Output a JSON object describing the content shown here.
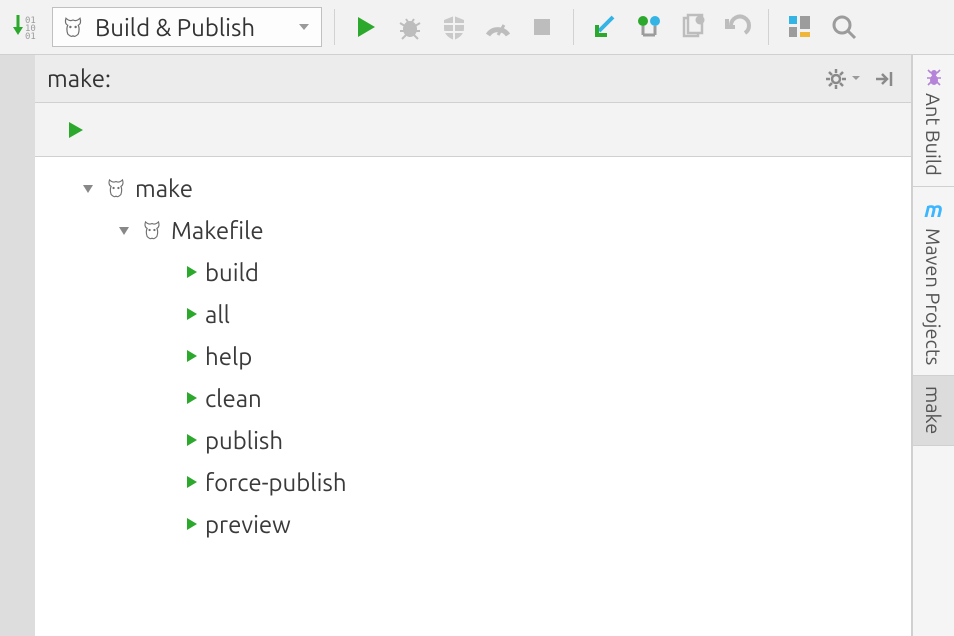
{
  "toolbar": {
    "run_config_label": "Build & Publish"
  },
  "panel": {
    "title": "make:"
  },
  "tree": {
    "root": {
      "label": "make"
    },
    "makefile": {
      "label": "Makefile"
    },
    "targets": [
      {
        "label": "build"
      },
      {
        "label": "all"
      },
      {
        "label": "help"
      },
      {
        "label": "clean"
      },
      {
        "label": "publish"
      },
      {
        "label": "force-publish"
      },
      {
        "label": "preview"
      }
    ]
  },
  "side_tabs": {
    "ant": "Ant Build",
    "maven": "Maven Projects",
    "make": "make"
  }
}
